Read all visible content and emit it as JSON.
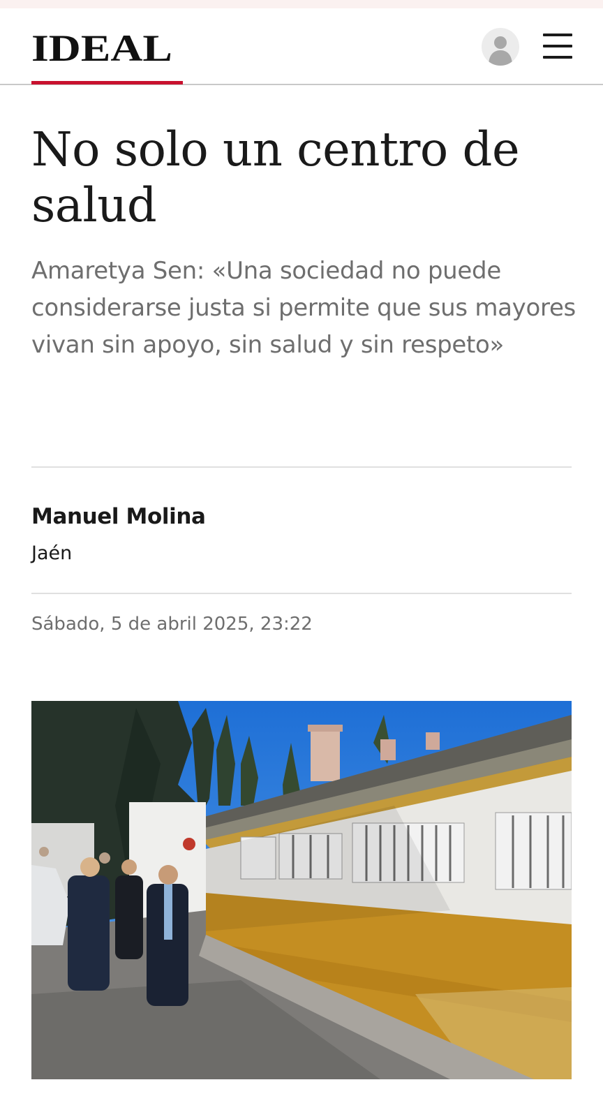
{
  "header": {
    "logo": "IDEAL",
    "brand_color": "#c8102e",
    "avatar_icon": "user-avatar-icon",
    "menu_icon": "hamburger-menu-icon"
  },
  "article": {
    "headline": "No solo un centro de salud",
    "subtitle": "Amaretya Sen: «Una sociedad no puede considerarse justa si permite que sus mayores vivan sin apoyo, sin salud y sin respeto»",
    "author": "Manuel Molina",
    "location": "Jaén",
    "date": "Sábado, 5 de abril 2025, 23:22"
  }
}
